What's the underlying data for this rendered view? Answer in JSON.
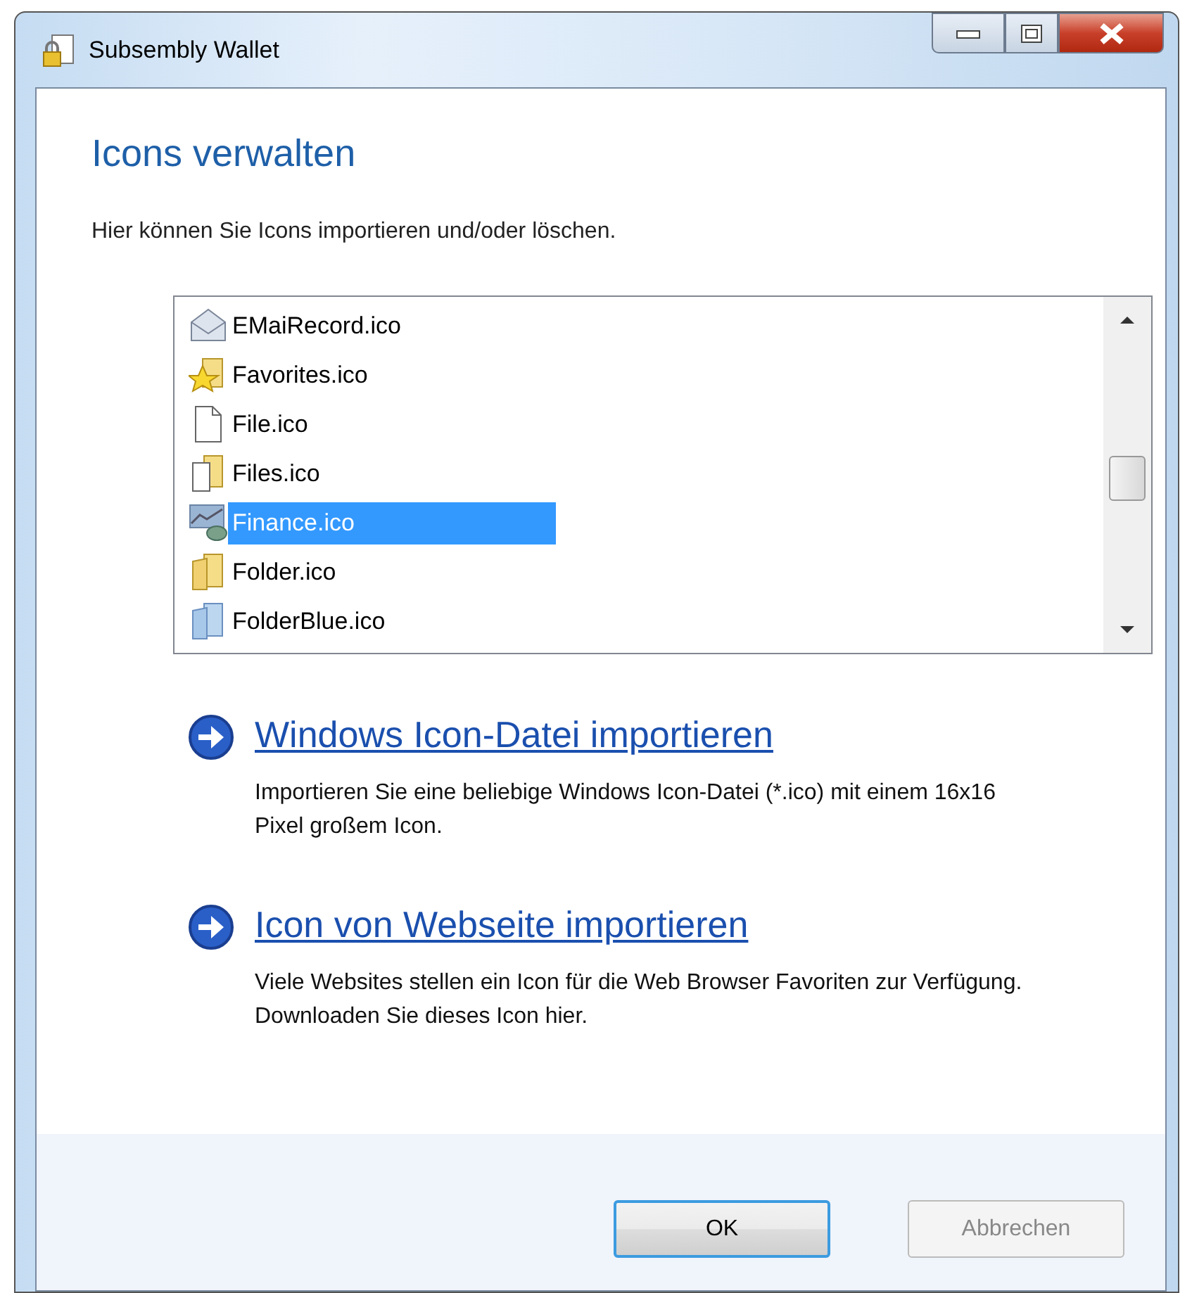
{
  "window": {
    "title": "Subsembly Wallet"
  },
  "heading": "Icons verwalten",
  "description": "Hier können Sie Icons importieren und/oder löschen.",
  "icon_list": [
    {
      "label": "EMaiRecord.ico",
      "kind": "envelope",
      "selected": false
    },
    {
      "label": "Favorites.ico",
      "kind": "star-folder",
      "selected": false
    },
    {
      "label": "File.ico",
      "kind": "file",
      "selected": false
    },
    {
      "label": "Files.ico",
      "kind": "files",
      "selected": false
    },
    {
      "label": "Finance.ico",
      "kind": "chart",
      "selected": true
    },
    {
      "label": "Folder.ico",
      "kind": "folder",
      "selected": false
    },
    {
      "label": "FolderBlue.ico",
      "kind": "folder-blue",
      "selected": false
    }
  ],
  "command_links": [
    {
      "title": "Windows Icon-Datei importieren",
      "text": "Importieren Sie eine beliebige Windows Icon-Datei (*.ico) mit einem 16x16 Pixel großem Icon."
    },
    {
      "title": "Icon von Webseite importieren",
      "text": "Viele Websites stellen ein Icon für die Web Browser Favoriten zur Verfügung. Downloaden Sie dieses Icon hier."
    }
  ],
  "buttons": [
    {
      "label": "OK",
      "default": true,
      "disabled": false
    },
    {
      "label": "Abbrechen",
      "default": false,
      "disabled": true
    }
  ]
}
